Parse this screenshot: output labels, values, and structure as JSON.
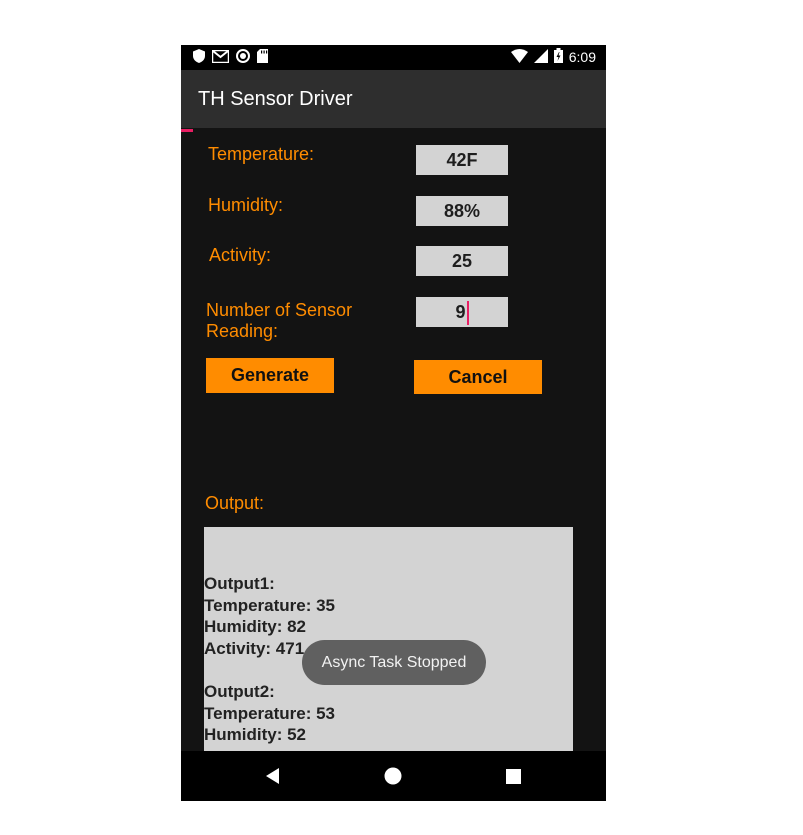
{
  "status_bar": {
    "time": "6:09",
    "battery_level": "full"
  },
  "app_bar": {
    "title": "TH Sensor Driver"
  },
  "form": {
    "temperature_label": "Temperature:",
    "temperature_value": "42F",
    "humidity_label": "Humidity:",
    "humidity_value": "88%",
    "activity_label": "Activity:",
    "activity_value": "25",
    "readings_label_line1": "Number of Sensor",
    "readings_label_line2": "Reading:",
    "readings_value": "9"
  },
  "buttons": {
    "generate": "Generate",
    "cancel": "Cancel"
  },
  "output": {
    "label": "Output:",
    "entries": [
      {
        "title": "Output1:",
        "temperature": "Temperature: 35",
        "humidity": "Humidity: 82",
        "activity": "Activity: 471"
      },
      {
        "title": "Output2:",
        "temperature": "Temperature: 53",
        "humidity": "Humidity: 52"
      }
    ]
  },
  "toast": {
    "message": "Async Task Stopped"
  },
  "colors": {
    "accent": "#ff8c00",
    "background": "#131313",
    "app_bar": "#2e2e2e",
    "cursor": "#e91e63",
    "field": "#d3d3d3"
  },
  "icons": [
    "shield-icon",
    "gmail-icon",
    "record-icon",
    "sd-card-icon",
    "wifi-icon",
    "signal-icon",
    "battery-icon",
    "back-icon",
    "home-icon",
    "recents-icon"
  ]
}
